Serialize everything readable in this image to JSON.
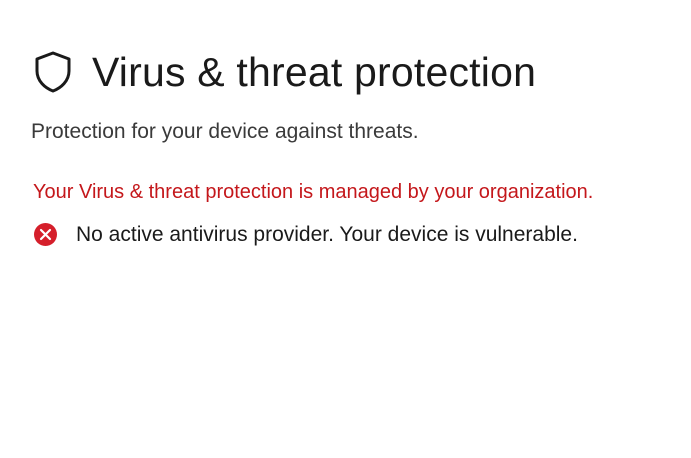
{
  "header": {
    "icon": "shield-icon",
    "title": "Virus & threat protection"
  },
  "subtitle": "Protection for your device against threats.",
  "managed_message": "Your Virus & threat protection is managed by your organization.",
  "status": {
    "icon": "error-icon",
    "text": "No active antivirus provider. Your device is vulnerable."
  },
  "colors": {
    "warning_text": "#c4171b",
    "error_icon": "#d51f2b",
    "title_text": "#1a1a1a"
  }
}
